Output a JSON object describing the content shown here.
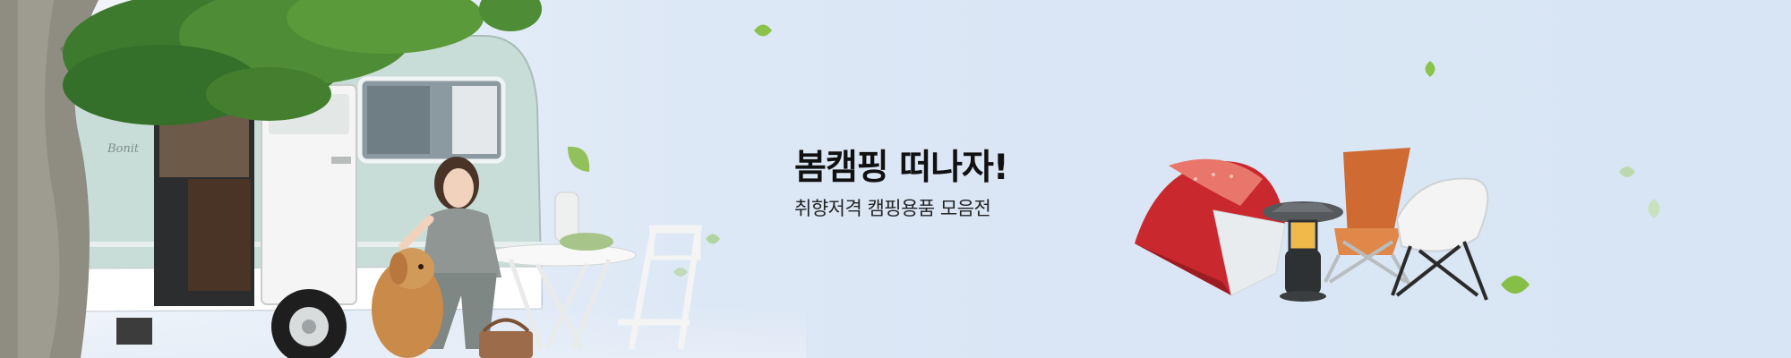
{
  "banner": {
    "headline": "봄캠핑 떠나자!",
    "subline": "취향저격 캠핑용품 모음전",
    "caravan_brand": "Bonit"
  },
  "icons": {
    "scene": "camper-scene-illustration",
    "products": [
      "tent-icon",
      "lantern-icon",
      "camping-chair-icon",
      "folding-chair-icon"
    ],
    "decor": "leaf-icon"
  },
  "colors": {
    "background": "#dce7f5",
    "headline": "#111111",
    "subline": "#222222",
    "leaf": "#8bc34a",
    "tent": "#c8282e",
    "caravan": "#c9ddd8"
  }
}
